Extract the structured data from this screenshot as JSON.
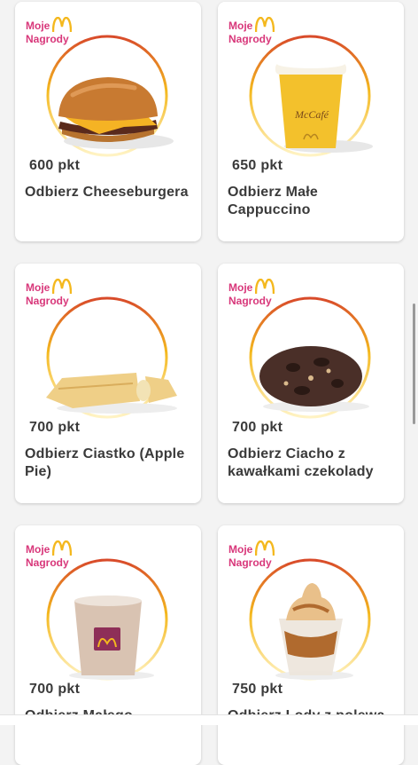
{
  "colors": {
    "badge_text": "#d8377a",
    "golden_arches": "#f4b81e",
    "ring_gradient": [
      "#d84a2a",
      "#f4b81e",
      "#fff3c4"
    ],
    "card_text": "#3a3a3a"
  },
  "badge": {
    "line1": "Moje",
    "line2": "Nagrody",
    "logo_icon": "golden-arches-icon"
  },
  "cards": [
    {
      "points": "600 pkt",
      "name": "Odbierz Cheeseburgera",
      "image": "cheeseburger"
    },
    {
      "points": "650 pkt",
      "name": "Odbierz Małe Cappuccino",
      "image": "mccafe-cappuccino-cup"
    },
    {
      "points": "700 pkt",
      "name": "Odbierz Ciastko (Apple Pie)",
      "image": "apple-pie"
    },
    {
      "points": "700 pkt",
      "name": "Odbierz Ciacho z kawałkami czekolady",
      "image": "chocolate-chunk-cookie"
    },
    {
      "points": "700 pkt",
      "name": "Odbierz Małego",
      "image": "milkshake-cup"
    },
    {
      "points": "750 pkt",
      "name": "Odbierz Lody z polewą",
      "image": "sundae-cup"
    }
  ]
}
